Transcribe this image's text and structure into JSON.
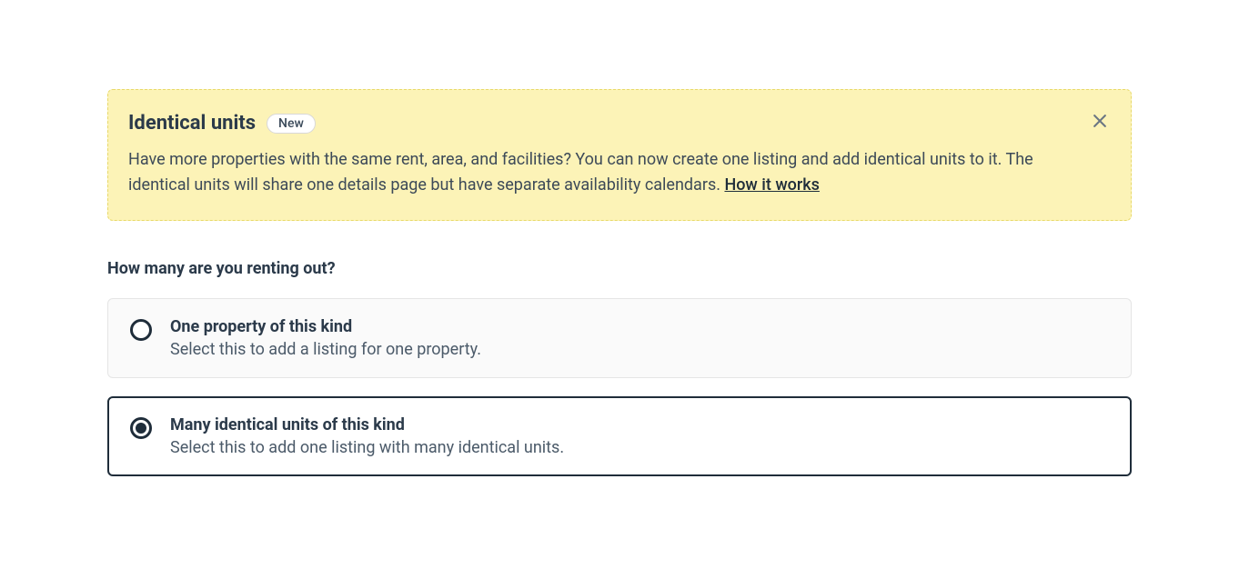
{
  "banner": {
    "title": "Identical units",
    "badge": "New",
    "body": "Have more properties with the same rent, area, and facilities? You can now create one listing and add identical units to it. The identical units will share one details page but have separate availability calendars. ",
    "link": "How it works"
  },
  "question": "How many are you renting out?",
  "options": [
    {
      "title": "One property of this kind",
      "desc": "Select this to add a listing for one property.",
      "selected": false
    },
    {
      "title": "Many identical units of this kind",
      "desc": "Select this to add one listing with many identical units.",
      "selected": true
    }
  ]
}
